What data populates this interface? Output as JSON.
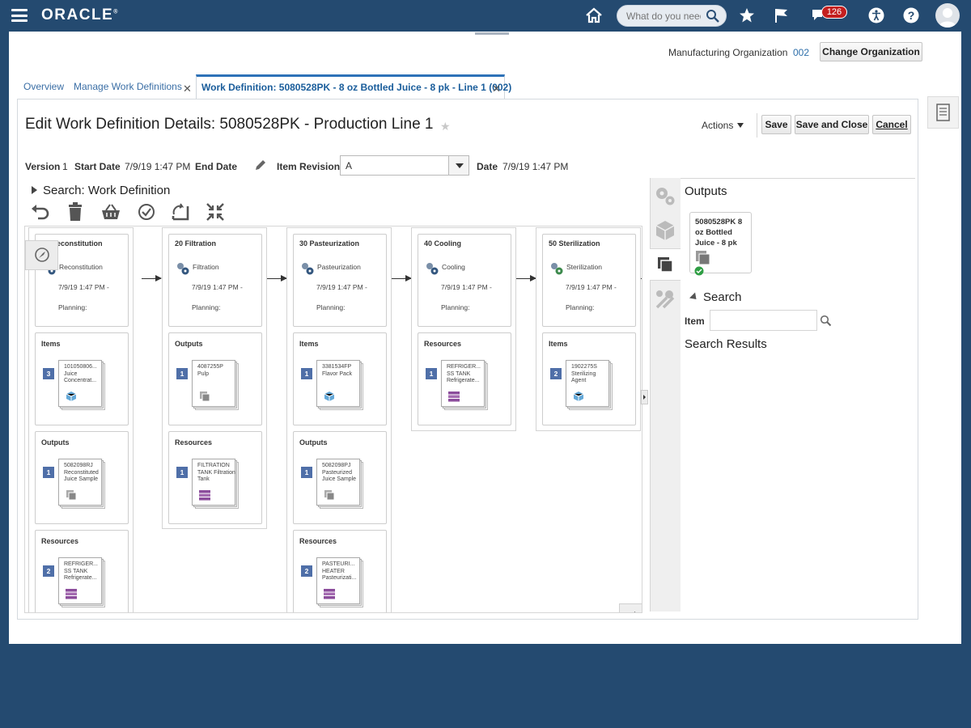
{
  "app": {
    "brand": "ORACLE"
  },
  "topbar": {
    "search_placeholder": "What do you need?",
    "notification_count": "126"
  },
  "header": {
    "org_label": "Manufacturing Organization",
    "org_value": "002",
    "change_org_label": "Change Organization"
  },
  "tabs": [
    {
      "label": "Overview"
    },
    {
      "label": "Manage Work Definitions"
    },
    {
      "label": "Work Definition: 5080528PK - 8 oz Bottled Juice - 8 pk - Line 1 (002)",
      "active": true
    }
  ],
  "page": {
    "title": "Edit Work Definition Details: 5080528PK - Production Line 1",
    "actions_label": "Actions",
    "save_label": "Save",
    "save_close_label": "Save and Close",
    "cancel_label": "Cancel"
  },
  "version_line": {
    "version_label": "Version",
    "version_value": "1",
    "start_date_label": "Start Date",
    "start_date_value": "7/9/19 1:47 PM",
    "end_date_label": "End Date",
    "item_revision_label": "Item Revision",
    "item_revision_value": "A",
    "date_label": "Date",
    "date_value": "7/9/19 1:47 PM"
  },
  "search_section": {
    "label": "Search: Work Definition"
  },
  "operations": [
    {
      "title": "10 Reconstitution",
      "name": "Reconstitution",
      "date": "7/9/19 1:47 PM -",
      "planning": "Planning:",
      "sections": [
        {
          "title": "Items",
          "count": "3",
          "text": "101050806... Juice Concentrat...",
          "icon": "cube-icon"
        },
        {
          "title": "Outputs",
          "count": "1",
          "text": "5082098RJ Reconstituted Juice Sample",
          "icon": "stack-icon"
        },
        {
          "title": "Resources",
          "count": "2",
          "text": "REFRIGER... SS TANK Refrigerate...",
          "icon": "resource-icon"
        }
      ]
    },
    {
      "title": "20 Filtration",
      "name": "Filtration",
      "date": "7/9/19 1:47 PM -",
      "planning": "Planning:",
      "sections": [
        {
          "title": "Outputs",
          "count": "1",
          "text": "4087255P Pulp",
          "icon": "stack-icon"
        },
        {
          "title": "Resources",
          "count": "1",
          "text": "FILTRATION TANK Filtration Tank",
          "icon": "resource-icon"
        }
      ]
    },
    {
      "title": "30 Pasteurization",
      "name": "Pasteurization",
      "date": "7/9/19 1:47 PM -",
      "planning": "Planning:",
      "sections": [
        {
          "title": "Items",
          "count": "1",
          "text": "3381534FP Flavor Pack",
          "icon": "cube-icon"
        },
        {
          "title": "Outputs",
          "count": "1",
          "text": "5082098PJ Pasteurized Juice Sample",
          "icon": "stack-icon"
        },
        {
          "title": "Resources",
          "count": "2",
          "text": "PASTEURI... HEATER Pasteurizati...",
          "icon": "resource-icon"
        }
      ]
    },
    {
      "title": "40 Cooling",
      "name": "Cooling",
      "date": "7/9/19 1:47 PM -",
      "planning": "Planning:",
      "sections": [
        {
          "title": "Resources",
          "count": "1",
          "text": "REFRIGER... SS TANK Refrigerate...",
          "icon": "resource-icon"
        }
      ]
    },
    {
      "title": "50 Sterilization",
      "name": "Sterilization",
      "date": "7/9/19 1:47 PM -",
      "planning": "Planning:",
      "sections": [
        {
          "title": "Items",
          "count": "2",
          "text": "1902275S Sterilizing Agent",
          "icon": "cube-icon"
        }
      ]
    }
  ],
  "right_panel": {
    "outputs_title": "Outputs",
    "output_card_text": "5080528PK 8 oz Bottled Juice - 8 pk",
    "search_title": "Search",
    "item_label": "Item",
    "item_value": "",
    "results_title": "Search Results"
  },
  "colors": {
    "topbar": "#244a70",
    "accent": "#2d72b8",
    "badge": "#4f6fa8",
    "notification": "#c41f1f"
  }
}
